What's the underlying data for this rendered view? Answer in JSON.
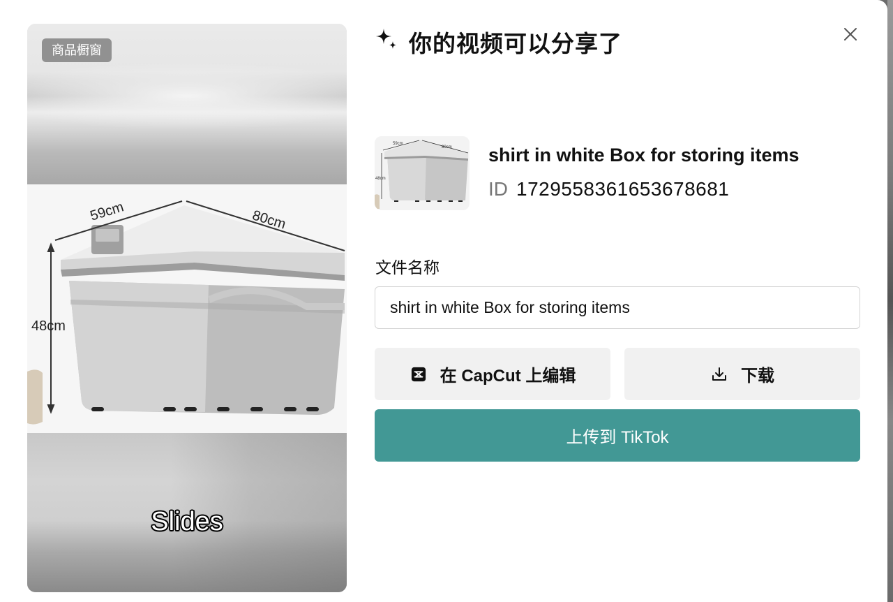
{
  "preview": {
    "badge": "商品橱窗",
    "caption": "Slides",
    "dimensions": {
      "width_label": "59cm",
      "depth_label": "80cm",
      "height_label": "48cm"
    }
  },
  "header": {
    "title": "你的视频可以分享了",
    "icon": "sparkle-icon",
    "close_icon": "close-icon"
  },
  "product": {
    "name": "shirt in white Box for storing items",
    "id_label": "ID",
    "id_value": "1729558361653678681"
  },
  "form": {
    "filename_label": "文件名称",
    "filename_value": "shirt in white Box for storing items"
  },
  "actions": {
    "capcut_label": "在 CapCut 上编辑",
    "capcut_icon": "capcut-icon",
    "download_label": "下载",
    "download_icon": "download-icon",
    "upload_label": "上传到 TikTok"
  },
  "colors": {
    "primary": "#429895",
    "secondary_bg": "#f1f1f1"
  }
}
